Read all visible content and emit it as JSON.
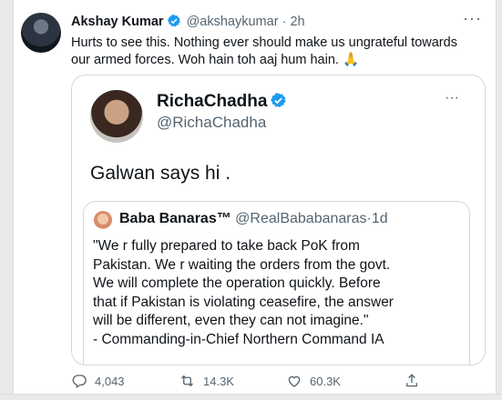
{
  "tweet": {
    "author_name": "Akshay Kumar",
    "author_handle": "@akshaykumar",
    "separator": "·",
    "time": "2h",
    "more": "···",
    "text": "Hurts to see this. Nothing ever should make us ungrateful towards our armed forces. Woh hain toh aaj hum hain. 🙏"
  },
  "quoted_tweet": {
    "author_name": "RichaChadha",
    "author_handle": "@RichaChadha",
    "more": "···",
    "text": "Galwan says hi ."
  },
  "nested_quote": {
    "author_name": "Baba Banaras™",
    "author_handle": "@RealBababanaras",
    "separator": "·",
    "time": "1d",
    "lines": [
      "\"We r fully prepared to take back PoK from",
      "Pakistan. We r waiting the orders from the govt.",
      "We will complete the operation quickly. Before",
      "that if Pakistan is violating ceasefire, the answer",
      "will be different, even they can not imagine.\"",
      "- Commanding-in-Chief Northern Command IA"
    ]
  },
  "actions": {
    "replies": "4,043",
    "retweets": "14.3K",
    "likes": "60.3K"
  },
  "colors": {
    "verified": "#1d9bf0",
    "secondary_text": "#536471",
    "border": "#cfd9de"
  },
  "icons": [
    "verified-badge-icon",
    "more-icon",
    "reply-icon",
    "retweet-icon",
    "like-icon",
    "share-icon"
  ]
}
